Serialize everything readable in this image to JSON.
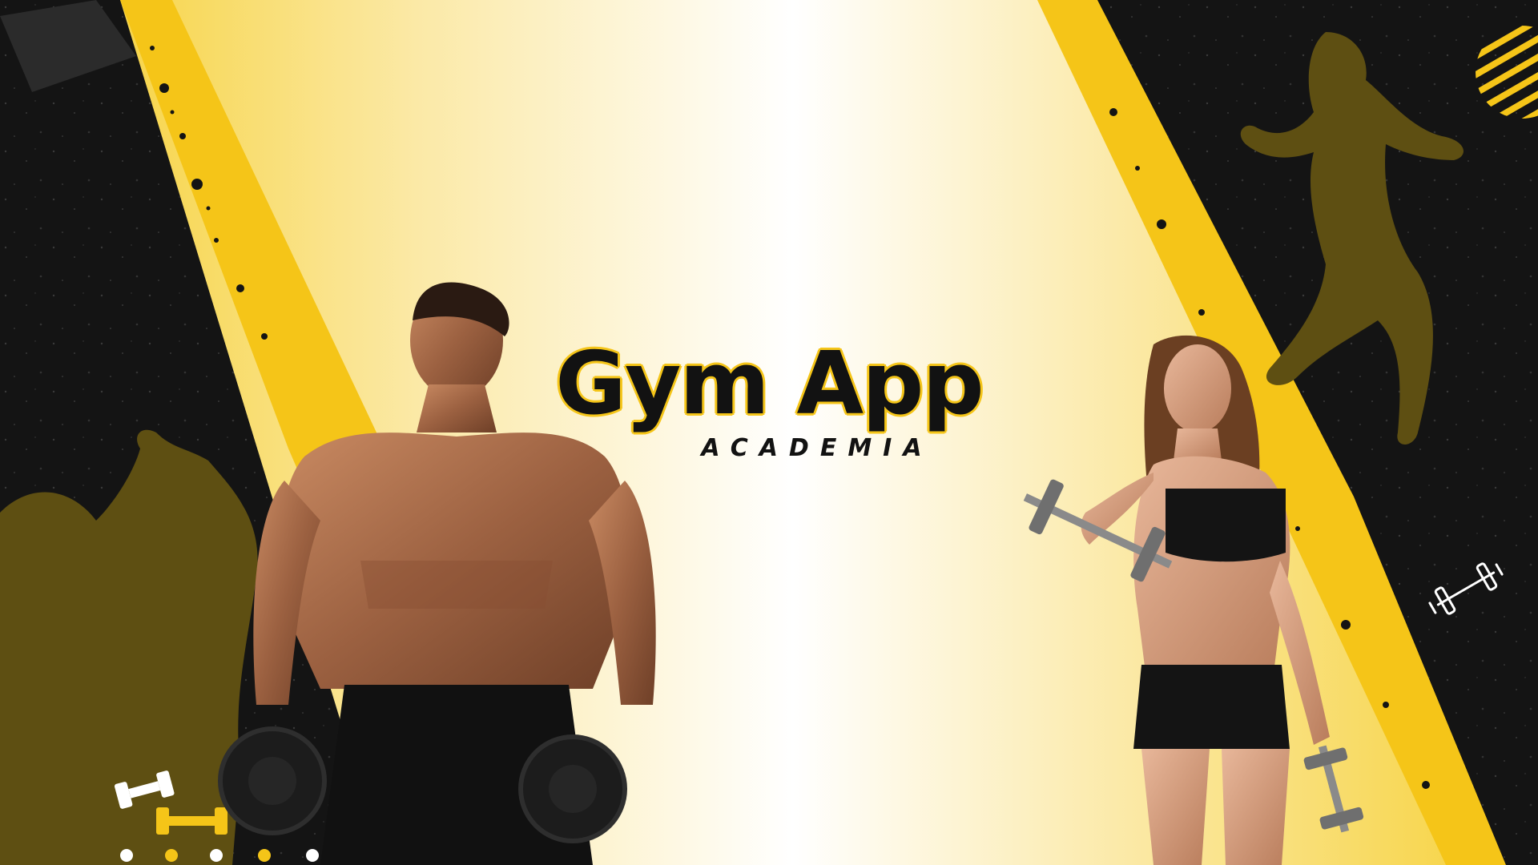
{
  "banner": {
    "title": "Gym App",
    "subtitle": "ACADEMIA"
  },
  "colors": {
    "accent": "#f5c518",
    "dark": "#141414",
    "silhouette": "#5e4f12",
    "light": "#ffffff"
  },
  "icons": {
    "top_right": "striped-circle-icon",
    "right_edge": "barbell-icon",
    "bottom_left": "dumbbell-icon",
    "bottom_row": "dotted-row"
  },
  "people": {
    "left": "muscular-man-with-dumbbells",
    "right": "fitness-woman-with-dumbbell"
  }
}
